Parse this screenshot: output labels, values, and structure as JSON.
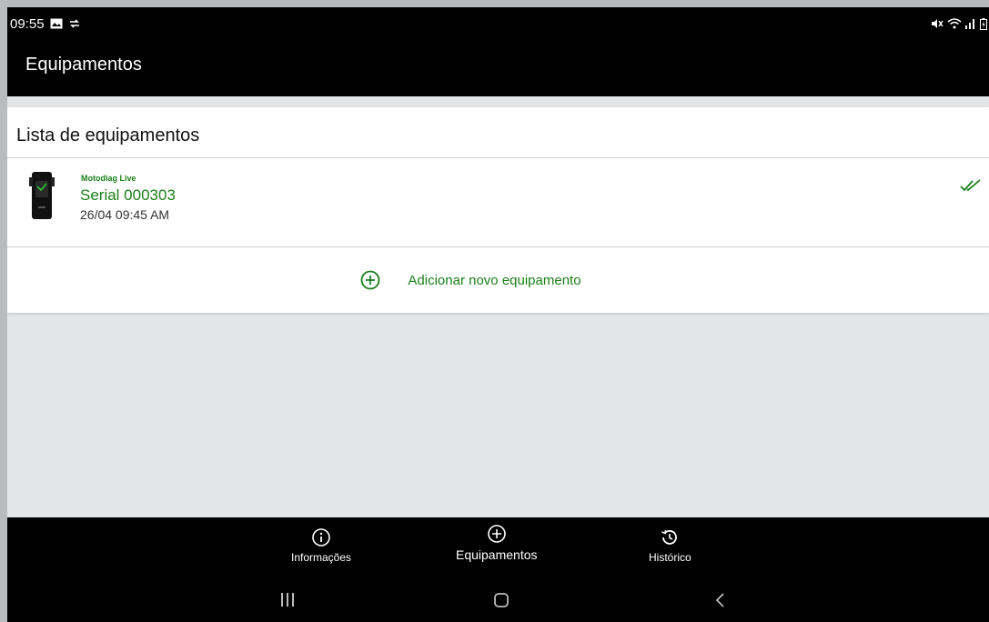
{
  "status_bar": {
    "time": "09:55"
  },
  "header": {
    "title": "Equipamentos"
  },
  "card": {
    "title": "Lista de equipamentos",
    "equipment": {
      "brand": "Motodiag Live",
      "serial": "Serial  000303",
      "date": "26/04 09:45 AM"
    },
    "add_label": "Adicionar novo equipamento"
  },
  "bottom_nav": {
    "items": [
      {
        "label": "Informações",
        "icon": "info-icon"
      },
      {
        "label": "Equipamentos",
        "icon": "add-circle-icon"
      },
      {
        "label": "Histórico",
        "icon": "history-icon"
      }
    ]
  },
  "colors": {
    "accent": "#1a7f1a",
    "bar": "#000000",
    "background": "#e4e5e6"
  }
}
